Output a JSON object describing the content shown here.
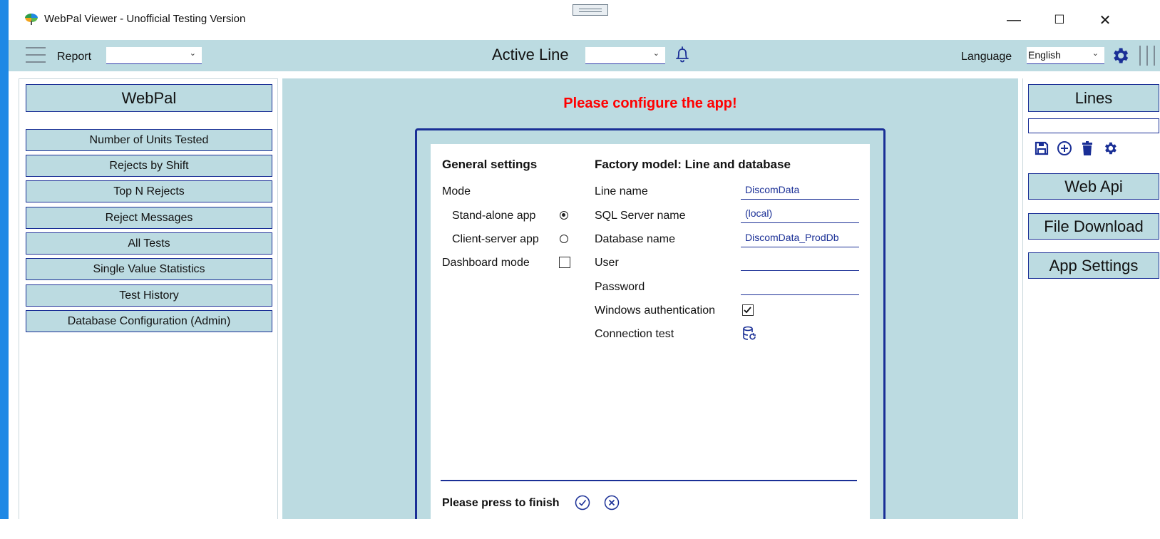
{
  "window": {
    "title": "WebPal Viewer - Unofficial Testing Version",
    "controls": {
      "minimize": "—",
      "maximize": "☐",
      "close": "✕"
    }
  },
  "toolbar": {
    "report_label": "Report",
    "report_value": "",
    "active_line_label": "Active Line",
    "active_line_value": "",
    "language_label": "Language",
    "language_value": "English"
  },
  "left_panel": {
    "header": "WebPal",
    "items": [
      "Number of Units Tested",
      "Rejects by Shift",
      "Top N Rejects",
      "Reject Messages",
      "All Tests",
      "Single Value Statistics",
      "Test History",
      "Database Configuration (Admin)"
    ]
  },
  "center": {
    "message": "Please configure the app!",
    "general": {
      "title": "General settings",
      "mode_label": "Mode",
      "standalone_label": "Stand-alone app",
      "standalone_selected": true,
      "client_server_label": "Client-server app",
      "client_server_selected": false,
      "dashboard_label": "Dashboard mode",
      "dashboard_checked": false
    },
    "factory": {
      "title": "Factory model: Line and database",
      "line_name_label": "Line name",
      "line_name_value": "DiscomData",
      "sql_server_label": "SQL Server name",
      "sql_server_value": "(local)",
      "database_label": "Database name",
      "database_value": "DiscomData_ProdDb",
      "user_label": "User",
      "user_value": "",
      "password_label": "Password",
      "password_value": "",
      "windows_auth_label": "Windows authentication",
      "windows_auth_checked": true,
      "connection_test_label": "Connection test"
    },
    "finish_label": "Please press to finish"
  },
  "right_panel": {
    "lines_header": "Lines",
    "lines_input_value": "",
    "web_api": "Web Api",
    "file_download": "File Download",
    "app_settings": "App Settings"
  },
  "icons": {
    "menu": "hamburger-icon",
    "bell": "bell-icon",
    "settings": "gear-icon",
    "save": "save-icon",
    "add": "add-circle-icon",
    "delete": "trash-icon",
    "confirm": "check-circle-icon",
    "cancel": "cancel-circle-icon",
    "connection": "database-refresh-icon"
  },
  "colors": {
    "accent": "#1a2f96",
    "panel": "#bcdbe1",
    "alert": "#ff0000",
    "strip": "#1e88e5"
  }
}
